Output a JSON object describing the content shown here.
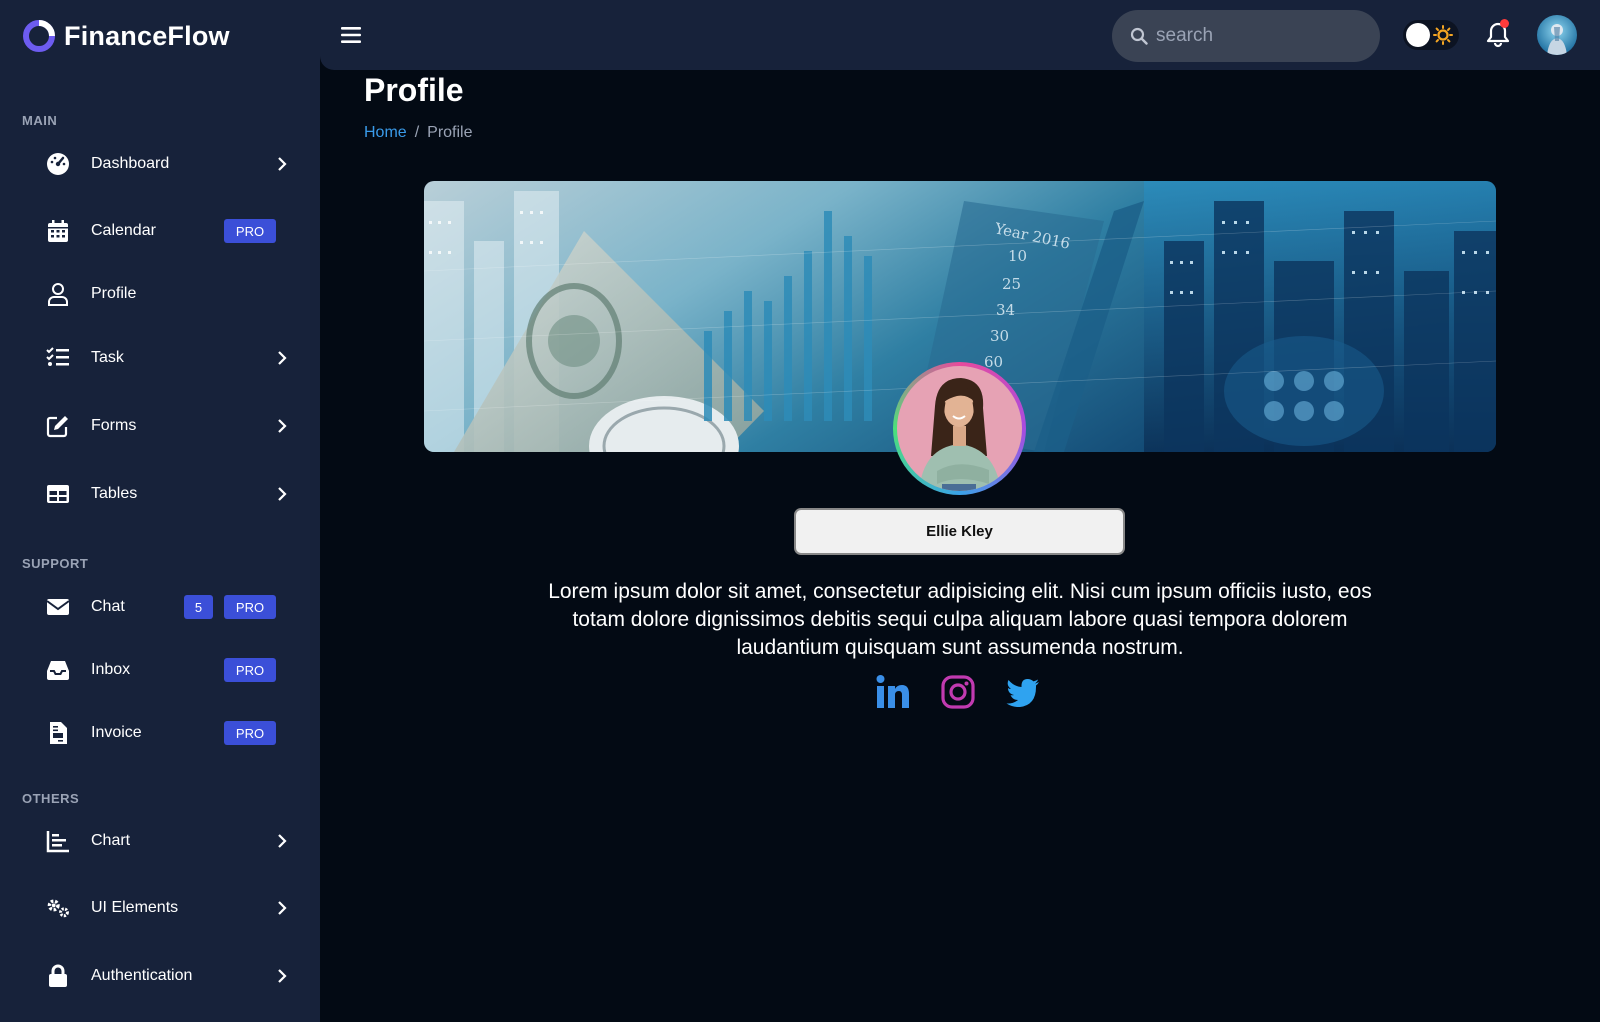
{
  "app": {
    "name": "FinanceFlow"
  },
  "sidebar": {
    "sections": [
      {
        "label": "MAIN"
      },
      {
        "label": "SUPPORT"
      },
      {
        "label": "OTHERS"
      }
    ],
    "items": [
      {
        "label": "Dashboard",
        "icon": "gauge-icon"
      },
      {
        "label": "Calendar",
        "icon": "calendar-icon",
        "badge": "PRO"
      },
      {
        "label": "Profile",
        "icon": "user-icon"
      },
      {
        "label": "Task",
        "icon": "checklist-icon"
      },
      {
        "label": "Forms",
        "icon": "edit-icon"
      },
      {
        "label": "Tables",
        "icon": "table-icon"
      },
      {
        "label": "Chat",
        "icon": "envelope-icon",
        "count": "5",
        "badge": "PRO"
      },
      {
        "label": "Inbox",
        "icon": "inbox-icon",
        "badge": "PRO"
      },
      {
        "label": "Invoice",
        "icon": "invoice-icon",
        "badge": "PRO"
      },
      {
        "label": "Chart",
        "icon": "chart-icon"
      },
      {
        "label": "UI Elements",
        "icon": "gears-icon"
      },
      {
        "label": "Authentication",
        "icon": "lock-icon"
      }
    ]
  },
  "topbar": {
    "search_placeholder": "search"
  },
  "page": {
    "title": "Profile",
    "breadcrumb": {
      "home": "Home",
      "separator": "/",
      "current": "Profile"
    }
  },
  "profile": {
    "name": "Ellie Kley",
    "bio": "Lorem ipsum dolor sit amet, consectetur adipisicing elit. Nisi cum ipsum officiis iusto, eos totam dolore dignissimos debitis sequi culpa aliquam labore quasi tempora dolorem laudantium quisquam sunt assumenda nostrum.",
    "socials": [
      {
        "icon": "linkedin-icon",
        "color": "#3a8fe8"
      },
      {
        "icon": "instagram-icon",
        "color": "#c13ab0"
      },
      {
        "icon": "twitter-icon",
        "color": "#2fa3f0"
      }
    ]
  },
  "colors": {
    "sidebar_bg": "#17223a",
    "page_bg": "#030a14",
    "accent": "#3b4fd8",
    "link": "#3a9bea"
  }
}
